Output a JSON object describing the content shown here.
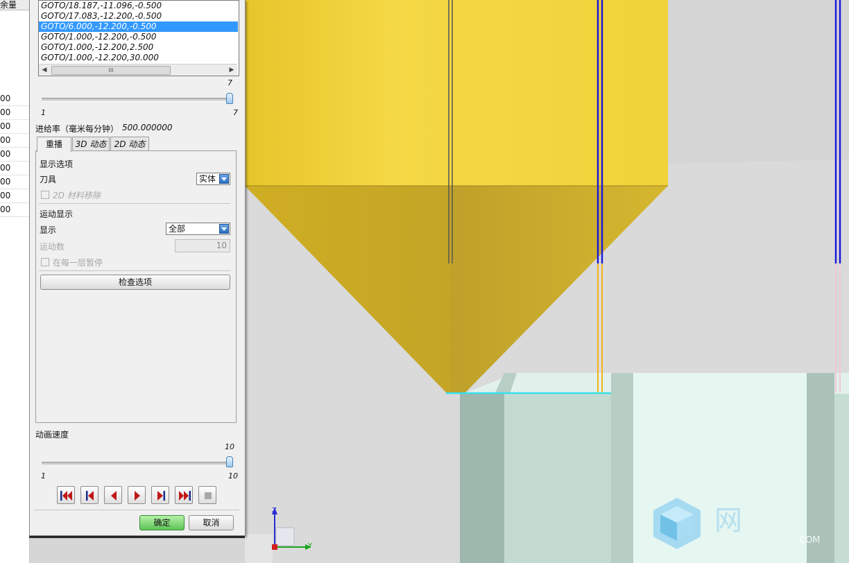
{
  "left_table": {
    "header": "余量",
    "rows": [
      "00",
      "00",
      "00",
      "00",
      "00",
      "00",
      "00",
      "00",
      "00"
    ]
  },
  "toolpath_list": {
    "items": [
      "GOTO/18.187,-11.096,-0.500",
      "GOTO/17.083,-12.200,-0.500",
      "GOTO/6.000,-12.200,-0.500",
      "GOTO/1.000,-12.200,-0.500",
      "GOTO/1.000,-12.200,2.500",
      "GOTO/1.000,-12.200,30.000"
    ],
    "selected_index": 2,
    "scroll_grip": "III"
  },
  "motion_slider": {
    "current": "7",
    "min": "1",
    "max": "7",
    "fraction": 1.0
  },
  "feedrate": {
    "label": "进给率（毫米每分钟）",
    "value": "500.000000"
  },
  "tabs": [
    {
      "label": "重播",
      "active": true
    },
    {
      "label": "3D 动态",
      "active": false
    },
    {
      "label": "2D 动态",
      "active": false
    }
  ],
  "display_options": {
    "section_title": "显示选项",
    "tool_label": "刀具",
    "tool_value": "实体",
    "material_removal_label": "2D 材料移除",
    "motion_section_title": "运动显示",
    "display_label": "显示",
    "display_value": "全部",
    "motion_count_label": "运动数",
    "motion_count_value": "10",
    "pause_label": "在每一层暂停",
    "check_options_button": "检查选项"
  },
  "animation_speed": {
    "label": "动画速度",
    "current": "10",
    "min": "1",
    "max": "10",
    "fraction": 1.0
  },
  "playback_buttons": [
    {
      "name": "rewind-to-start"
    },
    {
      "name": "step-back"
    },
    {
      "name": "play-reverse"
    },
    {
      "name": "play-forward"
    },
    {
      "name": "step-forward"
    },
    {
      "name": "fast-forward-end"
    },
    {
      "name": "stop"
    }
  ],
  "footer": {
    "ok_label": "确定",
    "cancel_label": "取消"
  },
  "triad": {
    "z_label": "Z",
    "y_label": "Y"
  },
  "watermark": {
    "char": "网",
    "suffix": "COM"
  },
  "colors": {
    "tool_yellow": "#f2d23a",
    "part_green": "#c5dcd2",
    "selection_blue": "#3399ff",
    "ok_button_green": "#6fd36a"
  }
}
